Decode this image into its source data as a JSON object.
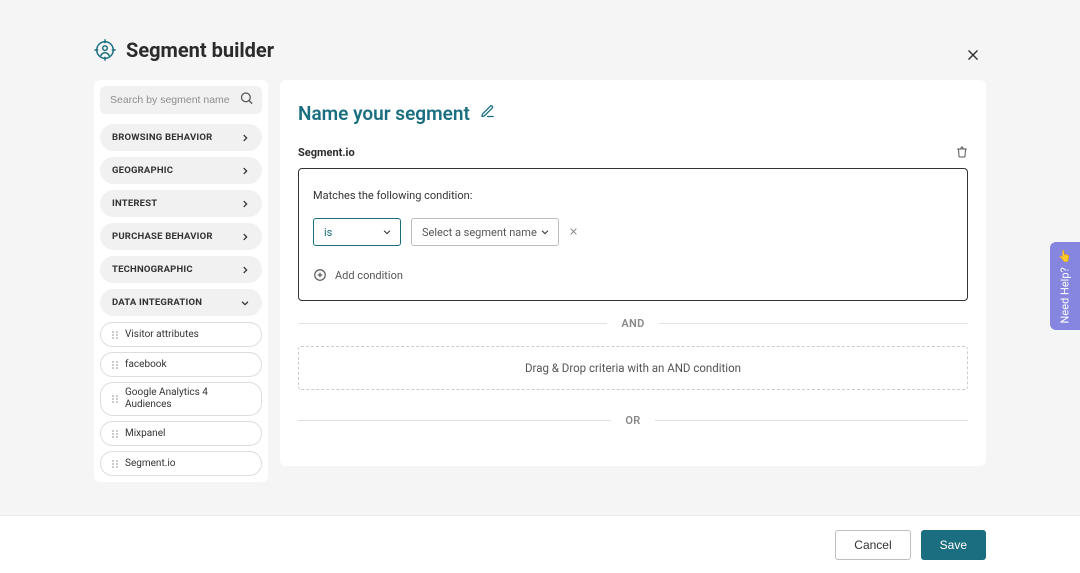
{
  "header": {
    "title": "Segment builder"
  },
  "search": {
    "placeholder": "Search by segment name"
  },
  "sidebar": {
    "categories": [
      {
        "label": "Browsing Behavior",
        "expanded": false
      },
      {
        "label": "Geographic",
        "expanded": false
      },
      {
        "label": "Interest",
        "expanded": false
      },
      {
        "label": "Purchase Behavior",
        "expanded": false
      },
      {
        "label": "Technographic",
        "expanded": false
      },
      {
        "label": "Data Integration",
        "expanded": true
      }
    ],
    "integration_items": [
      {
        "label": "Visitor attributes"
      },
      {
        "label": "facebook"
      },
      {
        "label": "Google Analytics 4 Audiences"
      },
      {
        "label": "Mixpanel"
      },
      {
        "label": "Segment.io"
      }
    ]
  },
  "main": {
    "segment_name": "Name your segment",
    "source_label": "Segment.io",
    "condition_title": "Matches the following condition:",
    "operator_value": "is",
    "select_placeholder": "Select a segment name",
    "add_condition_label": "Add condition",
    "and_label": "AND",
    "dropzone_text": "Drag & Drop criteria with an AND condition",
    "or_label": "OR"
  },
  "footer": {
    "cancel": "Cancel",
    "save": "Save"
  },
  "help_tab": {
    "label": "Need Help?",
    "emoji": "👉"
  }
}
